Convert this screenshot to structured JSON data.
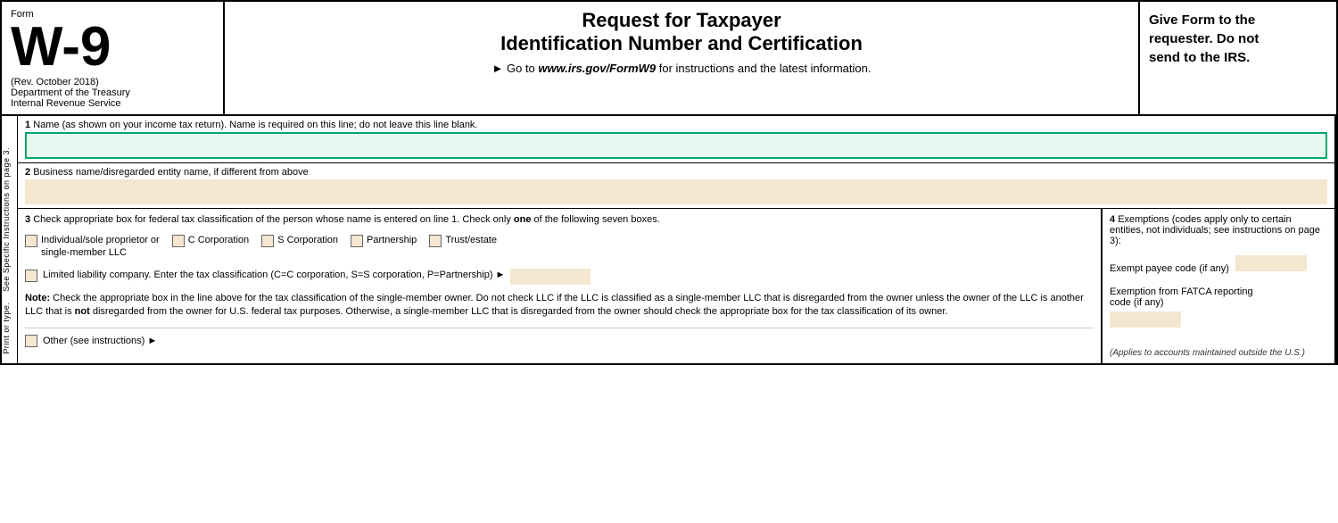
{
  "header": {
    "form_label": "Form",
    "form_number": "W-9",
    "rev": "(Rev. October 2018)",
    "dept1": "Department of the Treasury",
    "dept2": "Internal Revenue Service",
    "main_title_line1": "Request for Taxpayer",
    "main_title_line2": "Identification Number and Certification",
    "instruction": "► Go to",
    "url": "www.irs.gov/FormW9",
    "instruction_after": "for instructions and the latest information.",
    "right_text_line1": "Give Form to the",
    "right_text_line2": "requester. Do not",
    "right_text_line3": "send to the IRS."
  },
  "fields": {
    "field1_number": "1",
    "field1_label": "Name (as shown on your income tax return). Name is required on this line; do not leave this line blank.",
    "field2_number": "2",
    "field2_label": "Business name/disregarded entity name, if different from above"
  },
  "section3": {
    "number": "3",
    "title": "Check appropriate box for federal tax classification of the person whose name is entered on line 1. Check only",
    "title_bold": "one",
    "title_after": "of the following seven boxes.",
    "checkboxes": [
      {
        "id": "cb_individual",
        "label": "Individual/sole proprietor or\nsingle-member LLC"
      },
      {
        "id": "cb_c_corp",
        "label": "C Corporation"
      },
      {
        "id": "cb_s_corp",
        "label": "S Corporation"
      },
      {
        "id": "cb_partnership",
        "label": "Partnership"
      },
      {
        "id": "cb_trust",
        "label": "Trust/estate"
      }
    ],
    "llc_label": "Limited liability company. Enter the tax classification (C=C corporation, S=S corporation, P=Partnership) ►",
    "llc_id": "cb_llc",
    "note_bold": "Note:",
    "note_text": "Check the appropriate box in the line above for the tax classification of the single-member owner.  Do not check LLC if the LLC is classified as a single-member LLC that is disregarded from the owner unless the owner of the LLC is another LLC that is",
    "note_not_bold": "not",
    "note_text2": "disregarded from the owner for U.S. federal tax purposes. Otherwise, a single-member LLC that is disregarded from the owner should check the appropriate box for the tax classification of its owner.",
    "other_label": "Other (see instructions) ►"
  },
  "section4": {
    "number": "4",
    "title": "Exemptions (codes apply only to certain entities, not individuals; see instructions on page 3):",
    "exempt_payee_label": "Exempt payee code (if any)",
    "fatca_label": "Exemption from FATCA reporting",
    "fatca_label2": "code (if any)",
    "applies_note": "(Applies to accounts maintained outside the U.S.)"
  },
  "side_text": {
    "line1": "Print or type.",
    "line2": "See Specific Instructions on page 3."
  },
  "colors": {
    "green_border": "#00a86b",
    "tan_bg": "#f5e6d0",
    "input_bg": "#e8f8f0"
  }
}
